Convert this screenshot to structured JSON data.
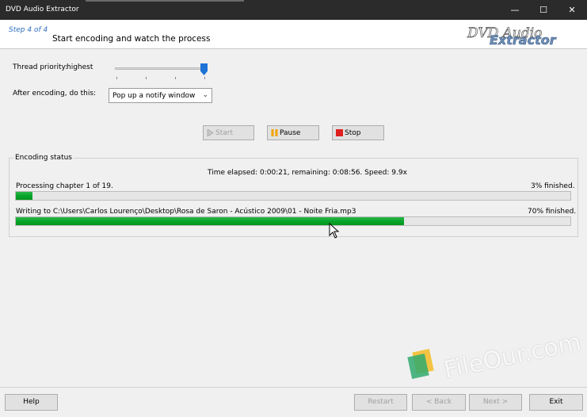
{
  "window": {
    "title": "DVD Audio Extractor",
    "controls": [
      "—",
      "☐",
      "✕"
    ]
  },
  "header": {
    "step": "Step 4 of 4",
    "title": "Start encoding and watch the process",
    "logo_line1": "DVD Audio",
    "logo_line2": "Extractor"
  },
  "settings": {
    "thread_priority_label": "Thread priority:",
    "thread_priority_value": "highest",
    "thread_priority_slider": 1.0,
    "after_encoding_label": "After encoding, do this:",
    "after_encoding_value": "Pop up a notify window"
  },
  "actions": {
    "start": "Start",
    "pause": "Pause",
    "stop": "Stop"
  },
  "status": {
    "group_label": "Encoding status",
    "time_line": "Time elapsed: 0:00:21, remaining: 0:08:56. Speed: 9.9x",
    "chapter_text": "Processing chapter 1 of 19.",
    "chapter_percent_text": "3% finished.",
    "chapter_progress": 0.03,
    "writing_text": "Writing to C:\\Users\\Carlos Lourenço\\Desktop\\Rosa de Saron - Acústico 2009\\01  - Noite Fria.mp3",
    "writing_percent_text": "70% finished.",
    "writing_progress": 0.7
  },
  "footer": {
    "help": "Help",
    "restart": "Restart",
    "back": "< Back",
    "next": "Next >",
    "exit": "Exit"
  },
  "watermark": {
    "text": "FileOur.com"
  },
  "colors": {
    "accent": "#1e73d6",
    "progress": "#07a52a",
    "titlebar": "#2b2b2b"
  }
}
